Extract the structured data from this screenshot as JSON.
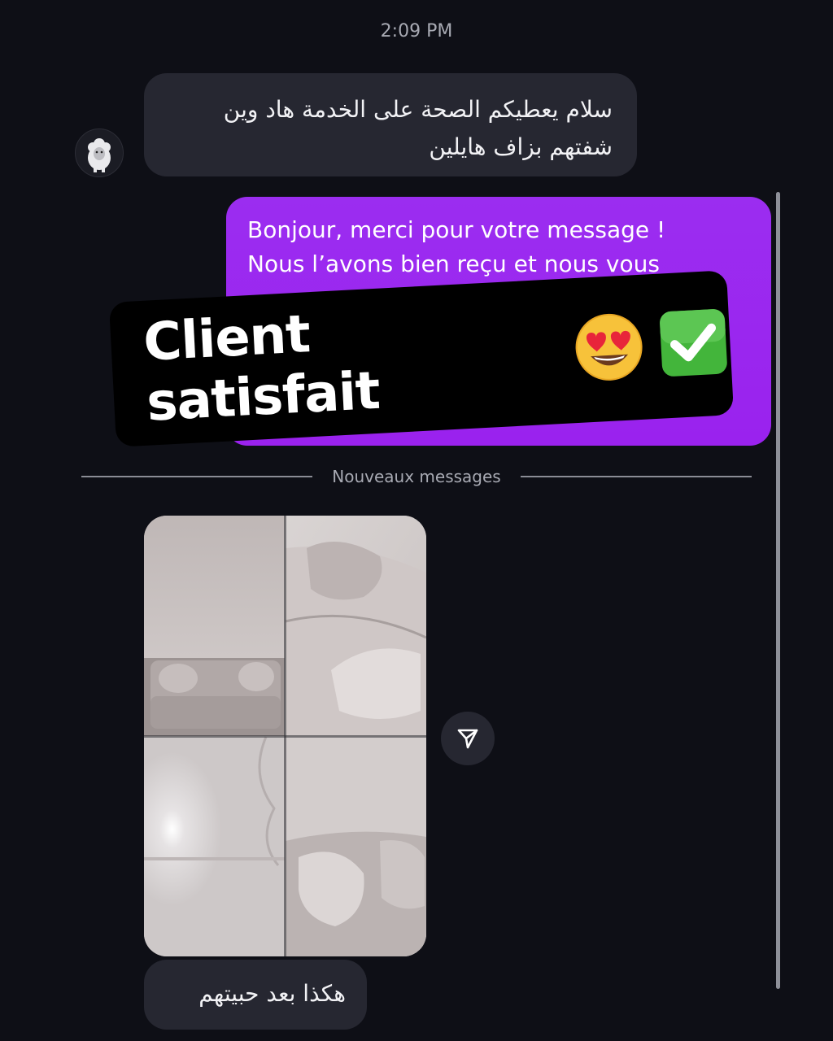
{
  "chat": {
    "timestamp": "2:09 PM",
    "incoming_message_1": "سلام يعطيكم الصحة على الخدمة هاد وين شفتهم بزاف هايلين",
    "outgoing_message_line_1": "Bonjour, merci pour votre message !",
    "outgoing_message_line_2": "Nous l’avons bien reçu et nous vous",
    "divider_label": "Nouveaux messages",
    "incoming_message_2": "هكذا بعد حبيتهم"
  },
  "overlay": {
    "text": "Client satisfait",
    "emojis": [
      "smiling-face-with-heart-eyes",
      "check-mark-button"
    ]
  },
  "icons": {
    "avatar": "sheep-avatar-icon",
    "share": "paper-plane-icon"
  },
  "colors": {
    "background": "#0e0f16",
    "incoming_bubble": "#262731",
    "outgoing_bubble": "#9a22ee",
    "overlay": "#000000"
  }
}
